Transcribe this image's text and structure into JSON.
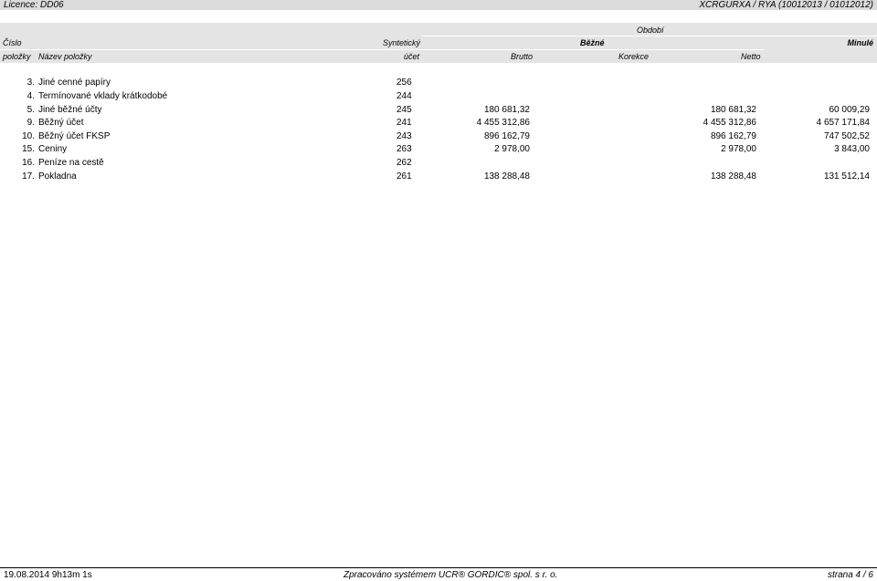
{
  "header": {
    "licence": "Licence: DD06",
    "report_id": "XCRGURXA / RYA  (10012013 / 01012012)"
  },
  "columns": {
    "obdobi": "Období",
    "cislo": "Číslo",
    "polozky": "položky",
    "nazev": "Název položky",
    "synteticky": "Syntetický",
    "ucet": "účet",
    "bezne": "Běžné",
    "minule": "Minulé",
    "brutto": "Brutto",
    "korekce": "Korekce",
    "netto": "Netto"
  },
  "rows": [
    {
      "num": "3.",
      "name": "Jiné cenné papíry",
      "account": "256",
      "brutto": "",
      "netto": "",
      "minule": ""
    },
    {
      "num": "4.",
      "name": "Termínované vklady krátkodobé",
      "account": "244",
      "brutto": "",
      "netto": "",
      "minule": ""
    },
    {
      "num": "5.",
      "name": "Jiné běžné účty",
      "account": "245",
      "brutto": "180 681,32",
      "netto": "180 681,32",
      "minule": "60 009,29"
    },
    {
      "num": "9.",
      "name": "Běžný účet",
      "account": "241",
      "brutto": "4 455 312,86",
      "netto": "4 455 312,86",
      "minule": "4 657 171,84"
    },
    {
      "num": "10.",
      "name": "Běžný účet FKSP",
      "account": "243",
      "brutto": "896 162,79",
      "netto": "896 162,79",
      "minule": "747 502,52"
    },
    {
      "num": "15.",
      "name": "Ceniny",
      "account": "263",
      "brutto": "2 978,00",
      "netto": "2 978,00",
      "minule": "3 843,00"
    },
    {
      "num": "16.",
      "name": "Peníze na cestě",
      "account": "262",
      "brutto": "",
      "netto": "",
      "minule": ""
    },
    {
      "num": "17.",
      "name": "Pokladna",
      "account": "261",
      "brutto": "138 288,48",
      "netto": "138 288,48",
      "minule": "131 512,14"
    }
  ],
  "footer": {
    "timestamp": "19.08.2014 9h13m 1s",
    "processed": "Zpracováno systémem  UCR® GORDIC® spol. s  r. o.",
    "page": "strana 4 / 6"
  }
}
